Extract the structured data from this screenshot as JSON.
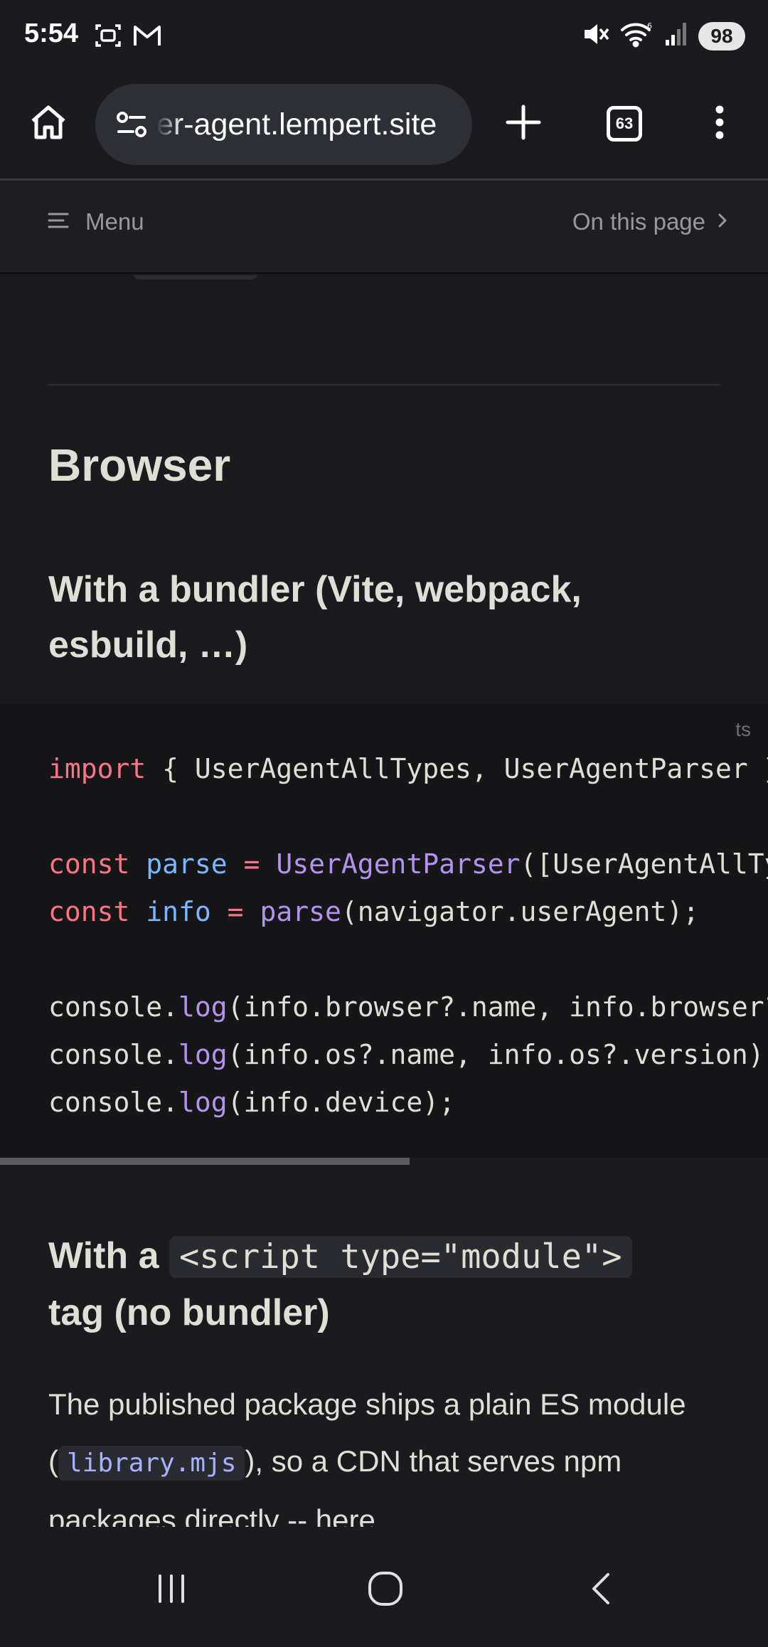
{
  "status_bar": {
    "time": "5:54",
    "battery": "98",
    "left_icons": [
      "screenshot-icon",
      "gmail-icon"
    ],
    "right_icons": [
      "mute-icon",
      "wifi-icon",
      "signal-icon"
    ]
  },
  "browser": {
    "url": "er-agent.lempert.site",
    "tab_count": "63",
    "icons": [
      "home-icon",
      "site-settings-icon",
      "plus-icon",
      "tabs-icon",
      "more-vert-icon"
    ]
  },
  "doc_nav": {
    "menu_label": "Menu",
    "on_this_page_label": "On this page"
  },
  "content": {
    "section_title": "Browser",
    "bundler_heading": "With a bundler (Vite, webpack, esbuild, …)",
    "code": {
      "lang": "ts",
      "lines": [
        [
          {
            "t": "import",
            "c": "kw"
          },
          {
            "t": " { UserAgentAllTypes, UserAgentParser } from 'user-agent-parser';",
            "c": "plain"
          }
        ],
        [],
        [
          {
            "t": "const",
            "c": "kw"
          },
          {
            "t": " ",
            "c": "plain"
          },
          {
            "t": "parse",
            "c": "var"
          },
          {
            "t": " = ",
            "c": "kw"
          },
          {
            "t": "UserAgentParser",
            "c": "fn"
          },
          {
            "t": "([UserAgentAllTypes]);",
            "c": "plain"
          }
        ],
        [
          {
            "t": "const",
            "c": "kw"
          },
          {
            "t": " ",
            "c": "plain"
          },
          {
            "t": "info",
            "c": "var"
          },
          {
            "t": " = ",
            "c": "kw"
          },
          {
            "t": "parse",
            "c": "fn"
          },
          {
            "t": "(navigator.userAgent);",
            "c": "plain"
          }
        ],
        [],
        [
          {
            "t": "console.",
            "c": "plain"
          },
          {
            "t": "log",
            "c": "fn"
          },
          {
            "t": "(info.browser?.name, info.browser?.version);",
            "c": "plain"
          }
        ],
        [
          {
            "t": "console.",
            "c": "plain"
          },
          {
            "t": "log",
            "c": "fn"
          },
          {
            "t": "(info.os?.name, info.os?.version);",
            "c": "plain"
          }
        ],
        [
          {
            "t": "console.",
            "c": "plain"
          },
          {
            "t": "log",
            "c": "fn"
          },
          {
            "t": "(info.device);",
            "c": "plain"
          }
        ]
      ]
    },
    "script_heading": {
      "prefix": "With a ",
      "code": "<script type=\"module\">",
      "suffix": "tag (no bundler)"
    },
    "paragraph": {
      "part1": "The published package ships a plain ES module (",
      "code": "library.mjs",
      "part2": "), so a CDN that serves npm packages directly -- here,"
    }
  },
  "android_nav": {
    "icons": [
      "recents-icon",
      "home-circle-icon",
      "back-icon"
    ]
  },
  "colors": {
    "background": "#1b1b1f",
    "code_background": "#161618",
    "keyword": "#f97583",
    "variable": "#79b8ff",
    "function": "#b392f0",
    "inline_code_link": "#a8b1ff"
  }
}
